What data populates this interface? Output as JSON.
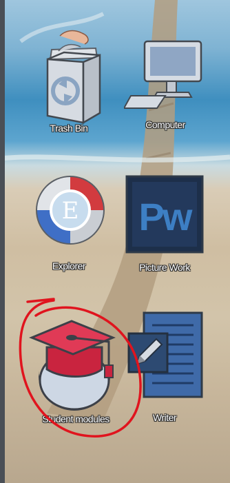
{
  "desktop": {
    "icons": {
      "trash_bin": {
        "label": "Trash Bin",
        "icon": "trash-bin-icon"
      },
      "computer": {
        "label": "Computer",
        "icon": "computer-icon"
      },
      "explorer": {
        "label": "Explorer",
        "icon": "explorer-icon",
        "logo_letter": "E"
      },
      "picture_work": {
        "label": "Picture Work",
        "icon": "picture-work-icon",
        "logo_text": "Pw"
      },
      "student_modules": {
        "label": "Student modules",
        "icon": "graduation-cap-icon"
      },
      "writer": {
        "label": "Writer",
        "icon": "writer-icon"
      }
    }
  },
  "colors": {
    "annotation_circle": "#e0141e",
    "cap_red": "#cf2a45",
    "picture_work_blue": "#3d7fc4"
  }
}
